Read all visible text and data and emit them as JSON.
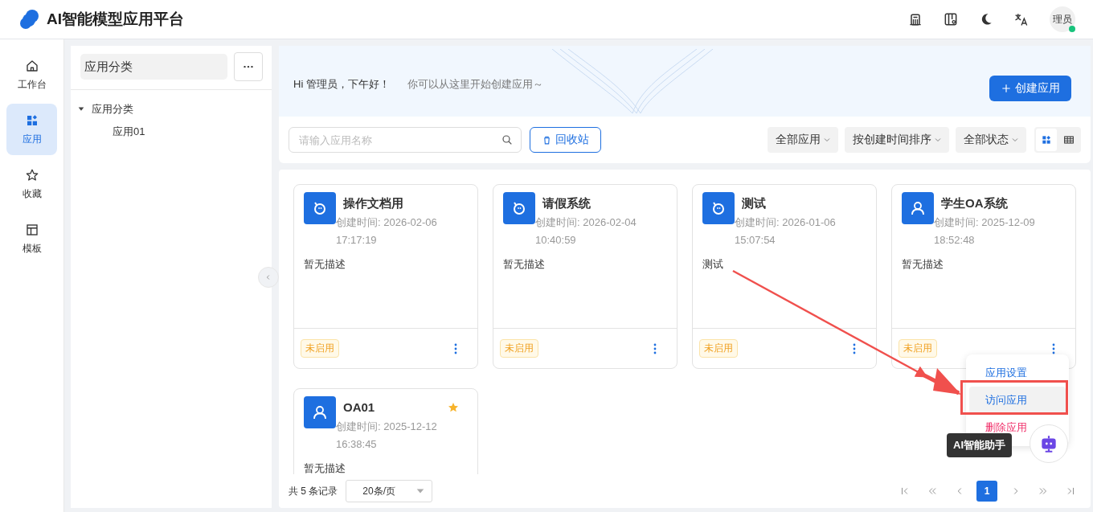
{
  "header": {
    "title": "AI智能模型应用平台",
    "avatar": "理员",
    "online": true
  },
  "nav": [
    {
      "label": "工作台",
      "kind": "home",
      "selected": false
    },
    {
      "label": "应用",
      "kind": "apps",
      "selected": true
    },
    {
      "label": "收藏",
      "kind": "star",
      "selected": false
    },
    {
      "label": "模板",
      "kind": "layout",
      "selected": false
    }
  ],
  "category_panel": {
    "title": "应用分类",
    "tree": [
      {
        "label": "应用分类",
        "expanded": true,
        "children": [
          {
            "label": "应用01"
          }
        ]
      }
    ]
  },
  "banner": {
    "greeting": "Hi 管理员，下午好！",
    "hint": "你可以从这里开始创建应用～",
    "create_button": "创建应用"
  },
  "toolbar": {
    "search": {
      "placeholder": "请输入应用名称"
    },
    "recycle_button": "回收站",
    "filters": [
      "全部应用",
      "按创建时间排序",
      "全部状态"
    ],
    "views": [
      {
        "kind": "grid",
        "selected": true
      },
      {
        "kind": "table",
        "selected": false
      }
    ]
  },
  "apps": [
    {
      "name": "操作文档用",
      "kind": "bot",
      "created": "创建时间: 2026-02-06 17:17:19",
      "description": "暂无描述",
      "status": "未启用",
      "starred": false
    },
    {
      "name": "请假系统",
      "kind": "bot",
      "created": "创建时间: 2026-02-04 10:40:59",
      "description": "暂无描述",
      "status": "未启用",
      "starred": false
    },
    {
      "name": "测试",
      "kind": "bot",
      "created": "创建时间: 2026-01-06 15:07:54",
      "description": "测试",
      "status": "未启用",
      "starred": false
    },
    {
      "name": "学生OA系统",
      "kind": "person",
      "created": "创建时间: 2025-12-09 18:52:48",
      "description": "暂无描述",
      "status": "未启用",
      "starred": false
    },
    {
      "name": "OA01",
      "kind": "person",
      "created": "创建时间: 2025-12-12 16:38:45",
      "description": "暂无描述",
      "starred": true
    }
  ],
  "menu": [
    {
      "label": "应用设置",
      "kind": "normal",
      "hovered": false
    },
    {
      "label": "访问应用",
      "kind": "normal",
      "hovered": true
    },
    {
      "label": "删除应用",
      "kind": "danger",
      "hovered": false
    }
  ],
  "assistant": {
    "tooltip": "AI智能助手"
  },
  "pagination": {
    "total": "共 5 条记录",
    "page_size": "20条/页",
    "pages": [
      {
        "label": "1",
        "selected": true
      }
    ]
  }
}
